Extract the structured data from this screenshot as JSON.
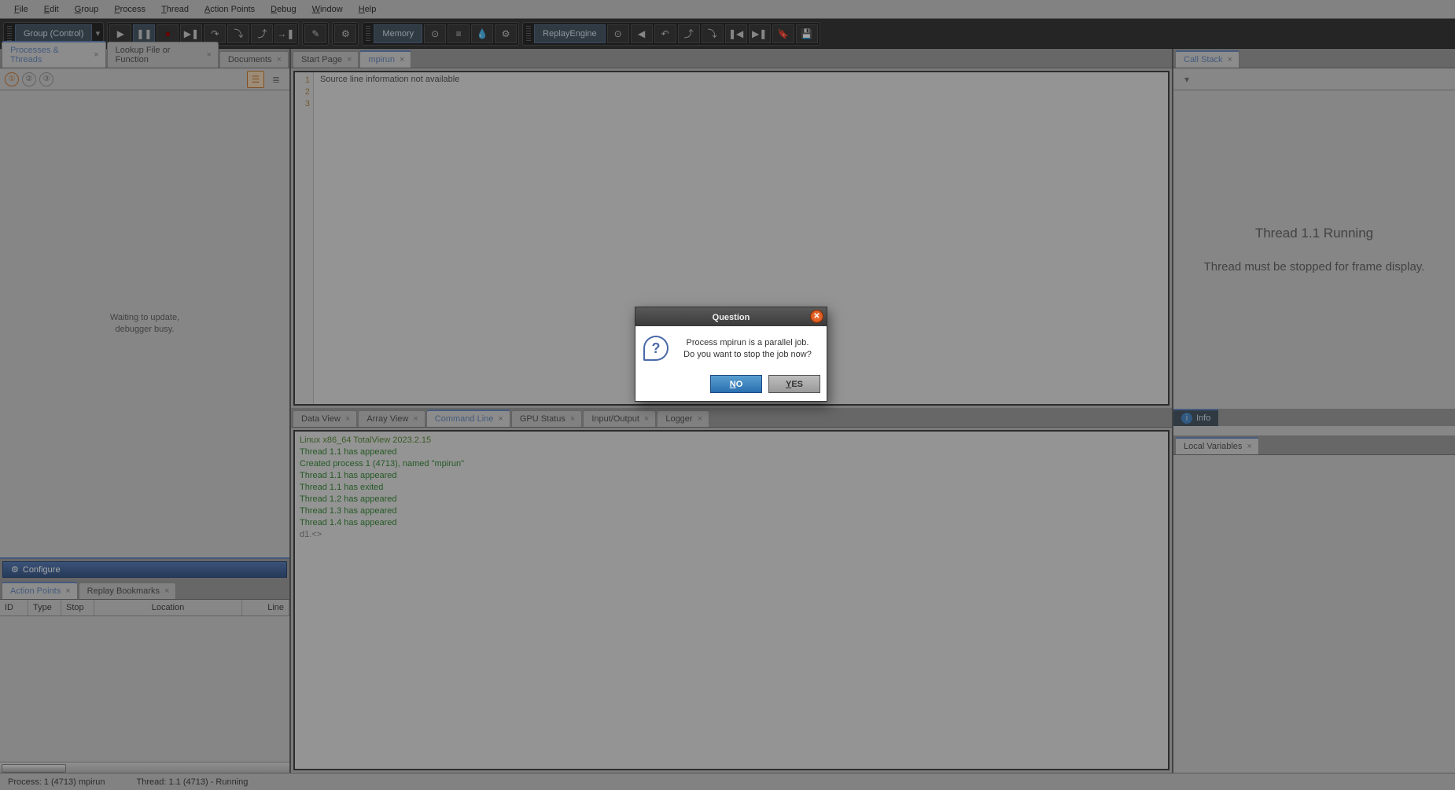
{
  "menu": [
    "File",
    "Edit",
    "Group",
    "Process",
    "Thread",
    "Action Points",
    "Debug",
    "Window",
    "Help"
  ],
  "menu_accel": [
    "F",
    "E",
    "G",
    "P",
    "T",
    "A",
    "D",
    "W",
    "H"
  ],
  "toolbar": {
    "group_label": "Group (Control)",
    "memory_label": "Memory",
    "replay_label": "ReplayEngine"
  },
  "left_tabs": [
    {
      "label": "Processes & Threads",
      "active": true
    },
    {
      "label": "Lookup File or Function",
      "active": false
    },
    {
      "label": "Documents",
      "active": false
    }
  ],
  "left_content": {
    "line1": "Waiting to update,",
    "line2": "debugger busy."
  },
  "configure_label": "Configure",
  "ap_tabs": [
    {
      "label": "Action Points",
      "active": true
    },
    {
      "label": "Replay Bookmarks",
      "active": false
    }
  ],
  "ap_cols": {
    "id": "ID",
    "type": "Type",
    "stop": "Stop",
    "location": "Location",
    "line": "Line"
  },
  "mid_tabs": [
    {
      "label": "Start Page",
      "active": false
    },
    {
      "label": "mpirun",
      "active": true
    }
  ],
  "source_text": "Source line information not available",
  "gutter_lines": [
    "1",
    "2",
    "3"
  ],
  "bottom_tabs": [
    {
      "label": "Data View",
      "active": false
    },
    {
      "label": "Array View",
      "active": false
    },
    {
      "label": "Command Line",
      "active": true
    },
    {
      "label": "GPU Status",
      "active": false
    },
    {
      "label": "Input/Output",
      "active": false
    },
    {
      "label": "Logger",
      "active": false
    }
  ],
  "cmd_lines": [
    {
      "text": "Linux x86_64 TotalView 2023.2.15",
      "cls": "sys"
    },
    {
      "text": "Thread 1.1 has appeared",
      "cls": ""
    },
    {
      "text": "Created process 1 (4713), named \"mpirun\"",
      "cls": ""
    },
    {
      "text": "Thread 1.1 has appeared",
      "cls": ""
    },
    {
      "text": "Thread 1.1 has exited",
      "cls": ""
    },
    {
      "text": "Thread 1.2 has appeared",
      "cls": ""
    },
    {
      "text": "Thread 1.3 has appeared",
      "cls": ""
    },
    {
      "text": "Thread 1.4 has appeared",
      "cls": ""
    },
    {
      "text": "d1.<>",
      "cls": "prompt"
    }
  ],
  "right_tabs": [
    {
      "label": "Call Stack",
      "active": true
    }
  ],
  "right_content": {
    "line1": "Thread 1.1 Running",
    "line2": "Thread must be stopped for frame display."
  },
  "info_label": "Info",
  "local_tabs": [
    {
      "label": "Local Variables",
      "active": true
    }
  ],
  "status": {
    "process": "Process: 1 (4713) mpirun",
    "thread": "Thread: 1.1 (4713) - Running"
  },
  "dialog": {
    "title": "Question",
    "msg1": "Process mpirun is a parallel job.",
    "msg2": "Do you want to stop the job now?",
    "no": "NO",
    "yes": "YES"
  }
}
